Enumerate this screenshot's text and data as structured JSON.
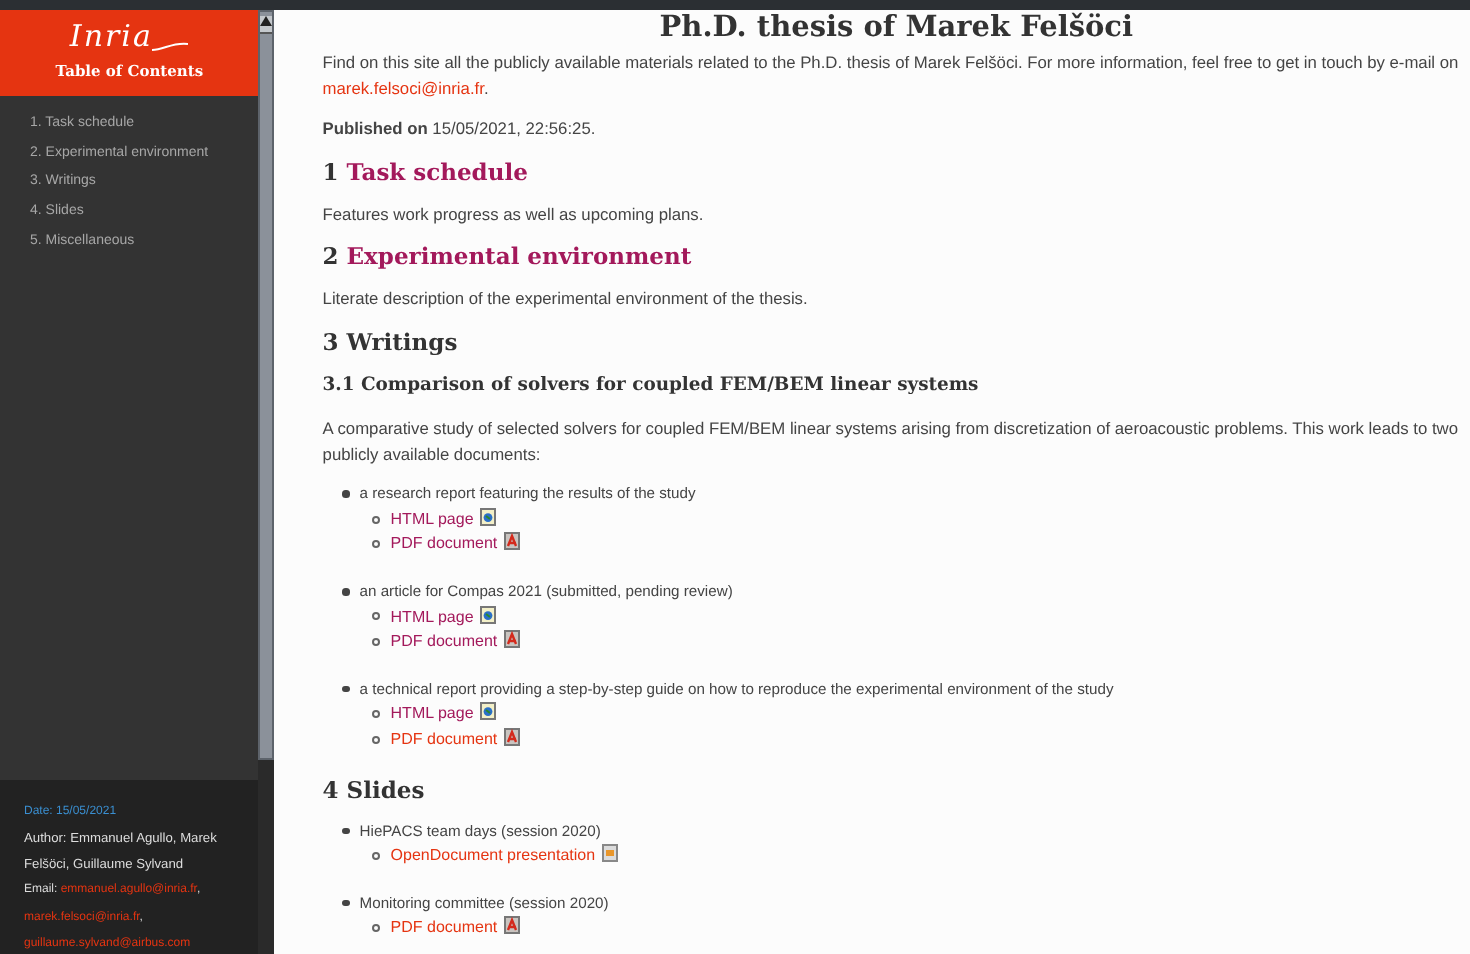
{
  "sidebar": {
    "logo": "Inria",
    "heading": "Table of Contents",
    "toc": [
      "1. Task schedule",
      "2. Experimental environment",
      "3. Writings",
      "4. Slides",
      "5. Miscellaneous"
    ],
    "footer": {
      "date": "Date: 15/05/2021",
      "author": "Author: Emmanuel Agullo, Marek Felšöci, Guillaume Sylvand",
      "email_label": "Email:",
      "emails": [
        {
          "address": "emmanuel.agullo@inria.fr",
          "suffix": ","
        },
        {
          "address": "marek.felsoci@inria.fr",
          "suffix": ","
        },
        {
          "address": "guillaume.sylvand@airbus.com"
        }
      ]
    }
  },
  "main": {
    "title": "Ph.D. thesis of Marek Felšöci",
    "intro": {
      "text": "Find on this site all the publicly available materials related to the Ph.D. thesis of Marek Felšöci. For more information, feel free to get in touch by e-mail on",
      "link": "marek.felsoci@inria.fr",
      "end": "."
    },
    "published": "**Published on** 15/05/2021, 22:56:25.",
    "sections": [
      {
        "number": "1",
        "title": "Task schedule",
        "kind": "link",
        "visited": true,
        "blocks": [
          {
            "kind": "paragraph",
            "text": "Features work progress as well as upcoming plans."
          }
        ]
      },
      {
        "number": "2",
        "title": "Experimental environment",
        "kind": "link",
        "visited": true,
        "blocks": [
          {
            "kind": "paragraph",
            "text": "Literate description of the experimental environment of the thesis."
          }
        ]
      },
      {
        "number": "3",
        "title": "Writings",
        "kind": "text",
        "blocks": [
          {
            "kind": "subheading",
            "text": "3.1 Comparison of solvers for coupled FEM/BEM linear systems"
          },
          {
            "kind": "paragraph",
            "text": "A comparative study of selected solvers for coupled FEM/BEM linear systems arising from discretization of aeroacoustic problems. This work leads to two publicly available documents:"
          },
          {
            "kind": "list",
            "items": [
              {
                "text": "a research report featuring the results of the study",
                "docs": [
                  {
                    "label": "HTML page",
                    "kind": "html",
                    "visited": true
                  },
                  {
                    "label": "PDF document",
                    "kind": "pdf",
                    "visited": true
                  }
                ]
              },
              {
                "text": "an article for Compas 2021 (submitted, pending review)",
                "docs": [
                  {
                    "label": "HTML page",
                    "kind": "html",
                    "visited": true
                  },
                  {
                    "label": "PDF document",
                    "kind": "pdf",
                    "visited": true
                  }
                ]
              },
              {
                "text": "a technical report providing a step-by-step guide on how to reproduce the experimental environment of the study",
                "docs": [
                  {
                    "label": "HTML page",
                    "kind": "html",
                    "visited": true
                  },
                  {
                    "label": "PDF document",
                    "kind": "pdf",
                    "visited": false
                  }
                ]
              }
            ]
          }
        ]
      },
      {
        "number": "4",
        "title": "Slides",
        "kind": "text",
        "blocks": [
          {
            "kind": "list",
            "items": [
              {
                "text": "HiePACS team days (session 2020)",
                "docs": [
                  {
                    "label": "OpenDocument presentation",
                    "kind": "odp",
                    "visited": false
                  }
                ]
              },
              {
                "text": "Monitoring committee (session 2020)",
                "docs": [
                  {
                    "label": "PDF document",
                    "kind": "pdf",
                    "visited": false
                  }
                ]
              }
            ]
          }
        ]
      }
    ]
  }
}
